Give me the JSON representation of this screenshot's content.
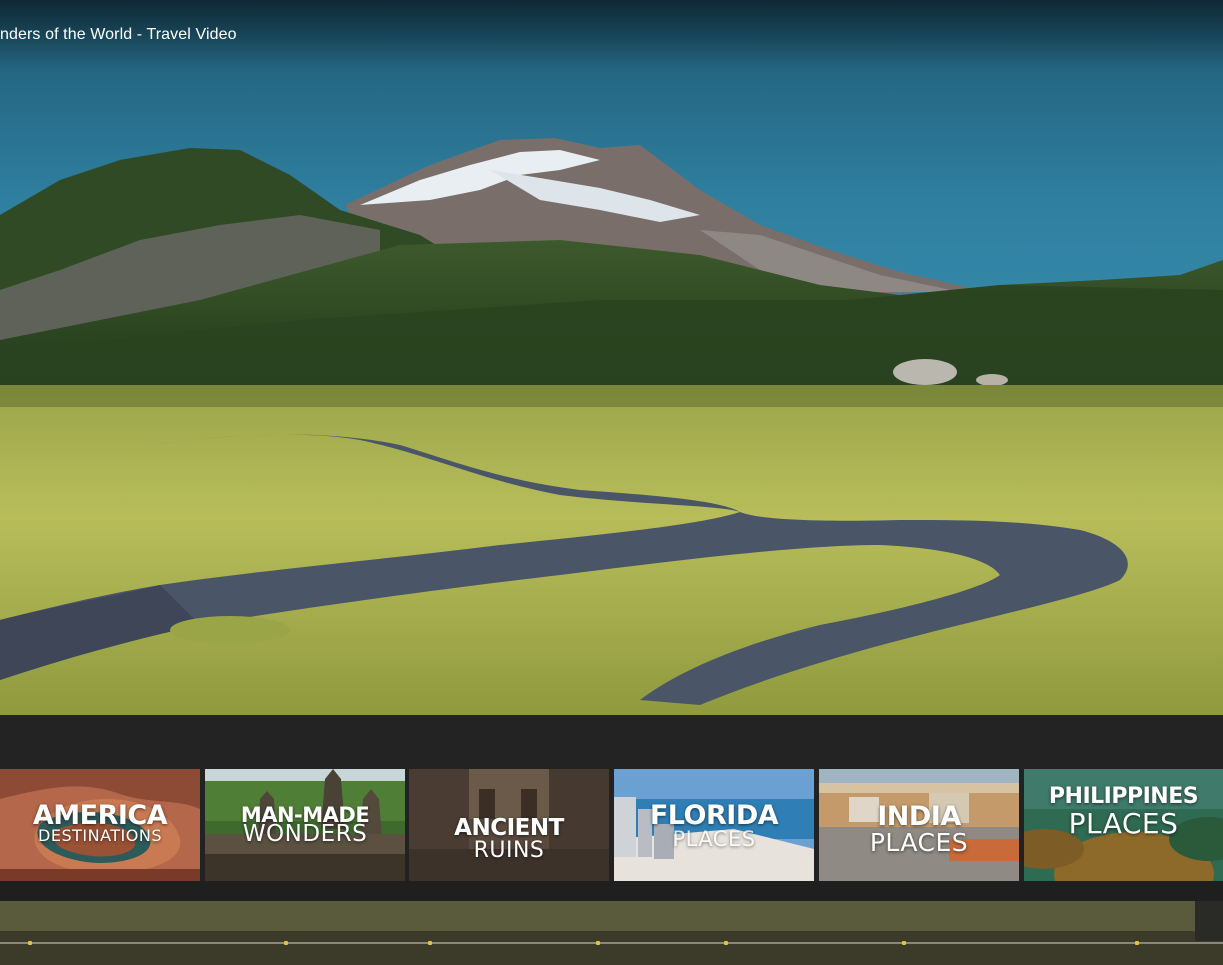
{
  "video": {
    "title": "nders of the World - Travel Video"
  },
  "colors": {
    "endscreen_bg": "#222222",
    "marker": "#e2c23a"
  },
  "endscreen": {
    "tiles": [
      {
        "line1": "AMERICA",
        "line2": "DESTINATIONS"
      },
      {
        "line1": "MAN-MADE",
        "line2": "WONDERS"
      },
      {
        "line1": "ANCIENT",
        "line2": "RUINS"
      },
      {
        "line1": "FLORIDA",
        "line2": "PLACES"
      },
      {
        "line1": "INDIA",
        "line2": "PLACES"
      },
      {
        "line1": "PHILIPPINES",
        "line2": "PLACES"
      }
    ]
  }
}
